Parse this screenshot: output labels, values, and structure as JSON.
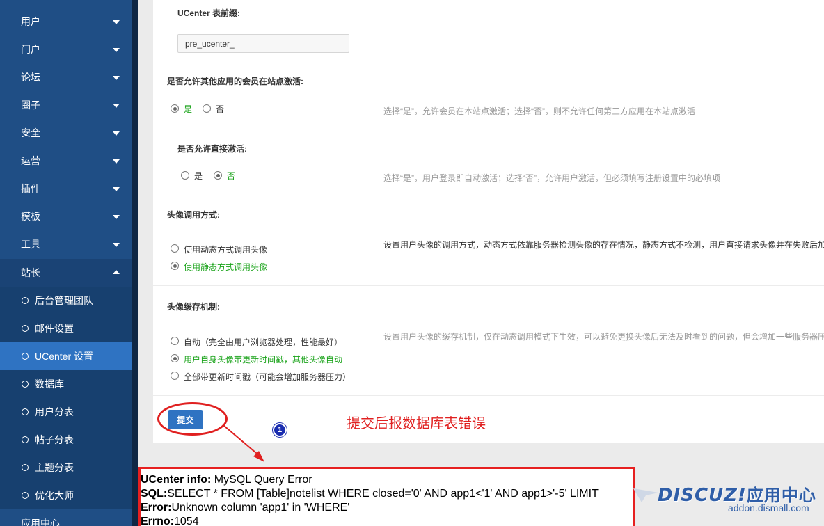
{
  "sidebar": {
    "items": [
      {
        "label": "用户"
      },
      {
        "label": "门户"
      },
      {
        "label": "论坛"
      },
      {
        "label": "圈子"
      },
      {
        "label": "安全"
      },
      {
        "label": "运营"
      },
      {
        "label": "插件"
      },
      {
        "label": "模板"
      },
      {
        "label": "工具"
      },
      {
        "label": "站长"
      }
    ],
    "subitems": [
      {
        "label": "后台管理团队"
      },
      {
        "label": "邮件设置"
      },
      {
        "label": "UCenter 设置"
      },
      {
        "label": "数据库"
      },
      {
        "label": "用户分表"
      },
      {
        "label": "帖子分表"
      },
      {
        "label": "主题分表"
      },
      {
        "label": "优化大师"
      }
    ],
    "bottom_item": "应用中心",
    "active_subitem": "UCenter 设置"
  },
  "form": {
    "prefix": {
      "label": "UCenter 表前缀:",
      "value": "pre_ucenter_"
    },
    "allow_other_activate": {
      "label": "是否允许其他应用的会员在站点激活:",
      "options": [
        "是",
        "否"
      ],
      "selected": "是",
      "hint": "选择“是”，允许会员在本站点激活；选择“否”，则不允许任何第三方应用在本站点激活"
    },
    "allow_direct_activate": {
      "label": "是否允许直接激活:",
      "options": [
        "是",
        "否"
      ],
      "selected": "否",
      "hint": "选择“是”，用户登录即自动激活；选择“否”，允许用户激活，但必须填写注册设置中的必填项"
    },
    "avatar_method": {
      "label": "头像调用方式:",
      "options": [
        "使用动态方式调用头像",
        "使用静态方式调用头像"
      ],
      "selected": "使用静态方式调用头像",
      "hint": "设置用户头像的调用方式，动态方式依靠服务器检测头像的存在情况，静态方式不检测，用户直接请求头像并在失败后加"
    },
    "avatar_cache": {
      "label": "头像缓存机制:",
      "options": [
        "自动（完全由用户浏览器处理，性能最好）",
        "用户自身头像带更新时间戳，其他头像自动",
        "全部带更新时间戳（可能会增加服务器压力）"
      ],
      "selected": "用户自身头像带更新时间戳，其他头像自动",
      "hint": "设置用户头像的缓存机制，仅在动态调用模式下生效，可以避免更换头像后无法及时看到的问题，但会增加一些服务器压"
    },
    "submit_label": "提交"
  },
  "annotation": {
    "badge": "1",
    "text": "提交后报数据库表错误"
  },
  "error": {
    "info_label": "UCenter info:",
    "info_value": " MySQL Query Error",
    "sql_label": "SQL:",
    "sql_value": "SELECT * FROM [Table]notelist WHERE closed='0' AND app1<'1' AND app1>'-5' LIMIT",
    "error_label": "Error:",
    "error_value": "Unknown column 'app1' in 'WHERE'",
    "errno_label": "Errno:",
    "errno_value": "1054"
  },
  "watermark": {
    "logo": "DISCUZ!",
    "logo_cn": "应用中心",
    "url": "addon.dismall.com"
  },
  "colors": {
    "sidebar_bg": "#1f4e85",
    "sidebar_active": "#2f73c2",
    "accent_green": "#1aa31a",
    "annotation_red": "#e02020"
  }
}
